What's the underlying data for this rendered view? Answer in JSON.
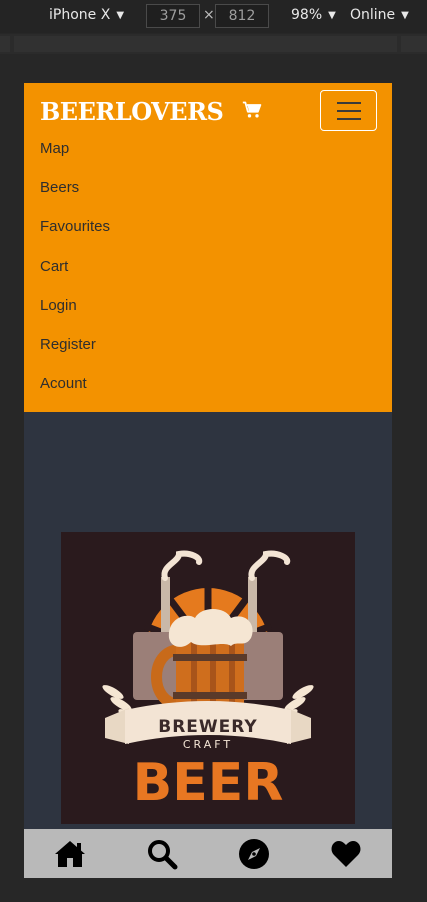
{
  "devtools": {
    "device": "iPhone X",
    "width": "375",
    "height": "812",
    "zoom": "98%",
    "network": "Online",
    "times": "×"
  },
  "app": {
    "brand": "BEERLOVERS",
    "menu": [
      "Map",
      "Beers",
      "Favourites",
      "Cart",
      "Login",
      "Register",
      "Acount"
    ],
    "logo": {
      "line1": "BREWERY",
      "line2": "CRAFT",
      "line3": "BEER"
    },
    "colors": {
      "navbar": "#f39200",
      "background": "#2e3440",
      "bottom_nav": "#b9b9b9"
    },
    "bottom_nav_icons": [
      "home-icon",
      "search-icon",
      "compass-icon",
      "heart-icon"
    ]
  }
}
